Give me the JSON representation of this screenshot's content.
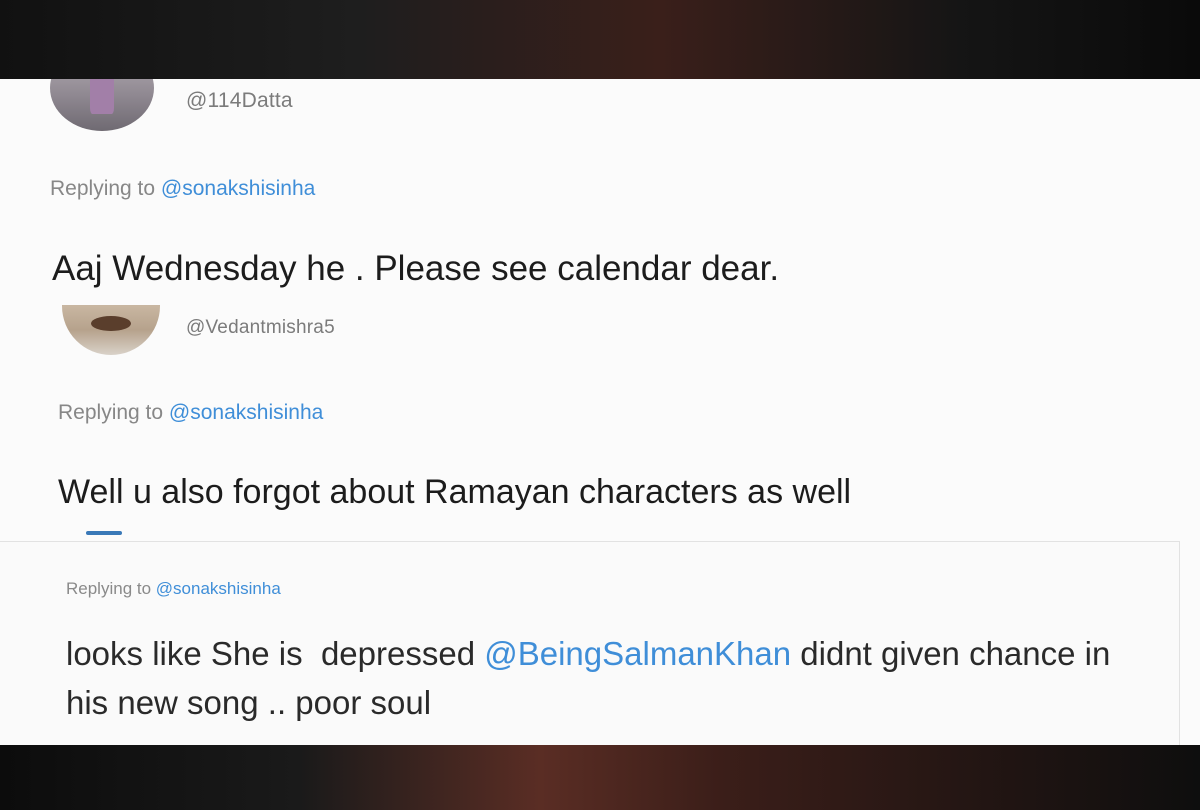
{
  "tweets": [
    {
      "handle": "@114Datta",
      "replying_prefix": "Replying to ",
      "replying_to": "@sonakshisinha",
      "text": "Aaj Wednesday he . Please see calendar dear."
    },
    {
      "handle": "@Vedantmishra5",
      "replying_prefix": "Replying to ",
      "replying_to": "@sonakshisinha",
      "text": "Well u also forgot about Ramayan characters as well"
    },
    {
      "replying_prefix": "Replying to ",
      "replying_to": "@sonakshisinha",
      "text_before": "looks like She is  depressed ",
      "mention": "@BeingSalmanKhan",
      "text_after": " didnt given chance in his new song .. poor soul"
    }
  ],
  "colors": {
    "mention": "#3f8ed8",
    "text": "#1c1c1c",
    "muted": "#878787"
  }
}
